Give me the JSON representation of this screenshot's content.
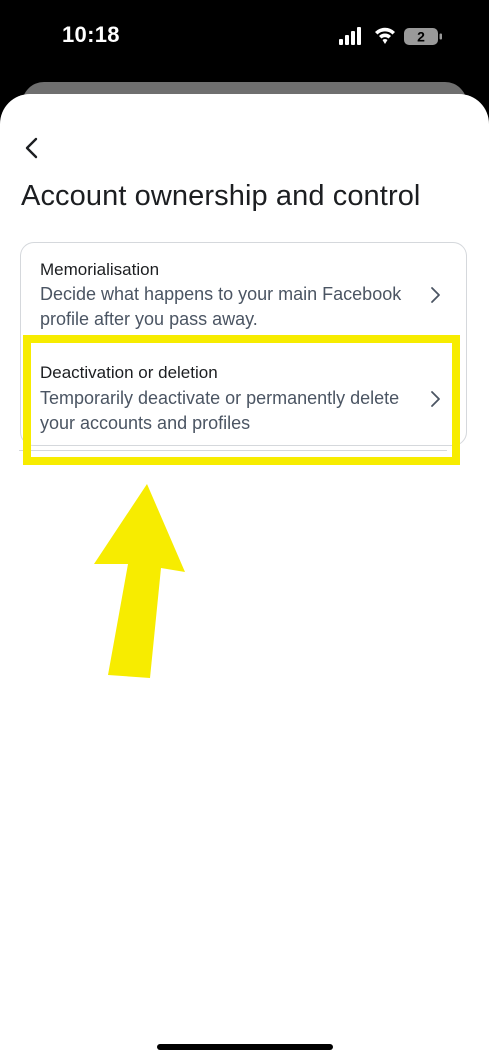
{
  "status_bar": {
    "time": "10:18",
    "battery_level": "2",
    "icons": [
      "cellular-signal-icon",
      "wifi-icon",
      "battery-icon"
    ]
  },
  "header": {
    "back_icon": "chevron-left-icon",
    "title": "Account ownership and control"
  },
  "options": [
    {
      "title": "Memorialisation",
      "description": "Decide what happens to your main Facebook profile after you pass away.",
      "icon": "chevron-right-icon"
    },
    {
      "title": "Deactivation or deletion",
      "description": "Temporarily deactivate or permanently delete your accounts and profiles",
      "icon": "chevron-right-icon"
    }
  ],
  "annotation": {
    "highlight_color": "#f7ec00",
    "target": "Deactivation or deletion"
  },
  "colors": {
    "background": "#ffffff",
    "text_primary": "#1c1e21",
    "text_secondary": "#4b5563",
    "border": "#d5d8dc"
  }
}
